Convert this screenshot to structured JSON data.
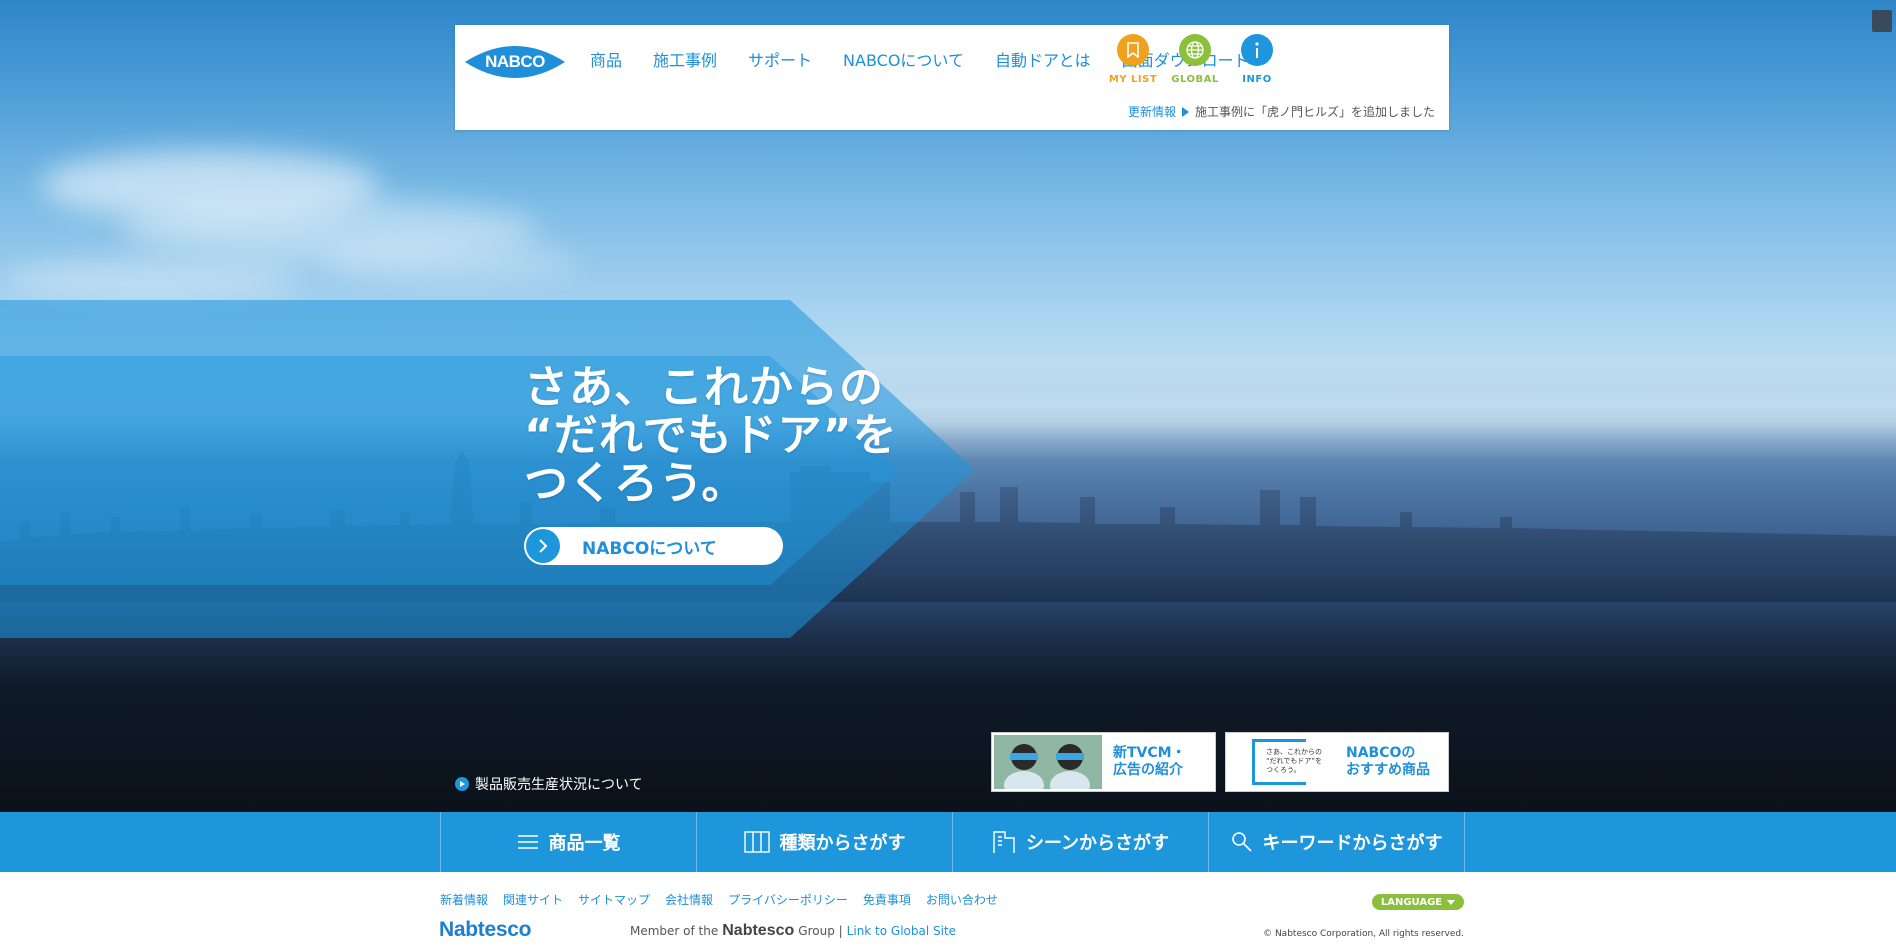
{
  "header": {
    "logo_text": "NABCO",
    "nav": [
      "商品",
      "施工事例",
      "サポート",
      "NABCOについて",
      "自動ドアとは",
      "図面ダウンロード"
    ],
    "utility": {
      "mylist": "MY LIST",
      "global": "GLOBAL",
      "info": "INFO"
    },
    "news": {
      "label": "更新情報",
      "text": "施工事例に「虎ノ門ヒルズ」を追加しました"
    }
  },
  "hero": {
    "headline": "さあ、これからの\n“だれでもドア”を\nつくろう。",
    "about_button": "NABCOについて",
    "notice": "製品販売生産状況について",
    "cards": [
      {
        "text": "新TVCM・\n広告の紹介"
      },
      {
        "text": "NABCOの\nおすすめ商品",
        "thumb_text": "さあ、これからの\n“だれでもドア”を\nつくろう。"
      }
    ]
  },
  "tabs": [
    "商品一覧",
    "種類からさがす",
    "シーンからさがす",
    "キーワードからさがす"
  ],
  "footer": {
    "links": [
      "新着情報",
      "関連サイト",
      "サイトマップ",
      "会社情報",
      "プライバシーポリシー",
      "免責事項",
      "お問い合わせ"
    ],
    "language": "LANGUAGE",
    "brand": "Nabtesco",
    "member_prefix": "Member of the",
    "member_brand": "Nabtesco",
    "member_suffix": "Group |",
    "global_link": "Link to Global Site",
    "copyright": "© Nabtesco Corporation, All rights reserved."
  },
  "colors": {
    "brand_blue": "#1e96dc",
    "mylist_orange": "#f0a21e",
    "global_green": "#8bbf3c",
    "info_blue": "#1e96dc"
  }
}
